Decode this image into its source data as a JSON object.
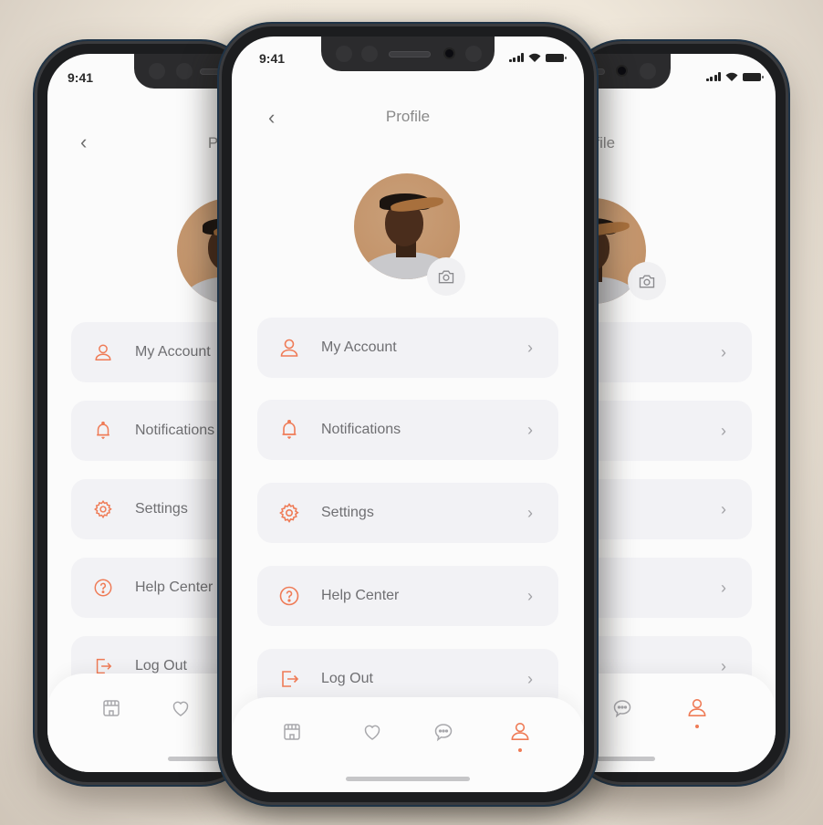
{
  "status_bar": {
    "time": "9:41"
  },
  "header": {
    "title": "Profile",
    "back_icon": "chevron-left-icon"
  },
  "profile": {
    "avatar_alt": "user-avatar",
    "camera_icon": "camera-icon"
  },
  "menu": {
    "items": [
      {
        "label": "My Account",
        "icon": "user-icon"
      },
      {
        "label": "Notifications",
        "icon": "bell-icon"
      },
      {
        "label": "Settings",
        "icon": "gear-icon"
      },
      {
        "label": "Help Center",
        "icon": "help-circle-icon"
      },
      {
        "label": "Log Out",
        "icon": "logout-icon"
      }
    ],
    "chevron": "›"
  },
  "tabbar": {
    "tabs": [
      {
        "name": "store",
        "icon": "store-icon",
        "active": false
      },
      {
        "name": "favorites",
        "icon": "heart-icon",
        "active": false
      },
      {
        "name": "messages",
        "icon": "chat-icon",
        "active": false
      },
      {
        "name": "profile",
        "icon": "user-icon",
        "active": true
      }
    ]
  },
  "colors": {
    "accent": "#ef7b56",
    "background": "#f1e9dd",
    "item_bg": "#f2f2f5",
    "text": "#6f6f72"
  }
}
